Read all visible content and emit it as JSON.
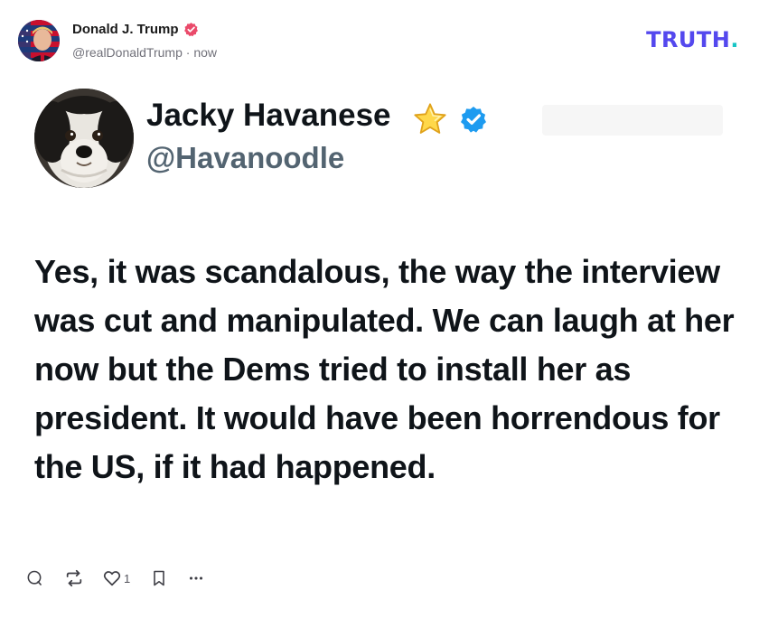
{
  "author": {
    "name": "Donald J. Trump",
    "handle": "@realDonaldTrump",
    "time": "now",
    "meta_separator": " · "
  },
  "brand": {
    "logo_text": "TRUTH",
    "logo_dot": ".",
    "color": "#5448ee",
    "dot_color": "#17c5c5"
  },
  "embedded_post": {
    "name": "Jacky Havanese",
    "handle": "@Havanoodle",
    "badge_icons": [
      "star-icon",
      "verified-icon"
    ],
    "text": "Yes, it was scandalous, the way the interview was cut and manipulated. We can laugh at her now but the Dems tried to install her as president. It would have been horrendous for the US, if it had happened."
  },
  "actions": {
    "icons": [
      "reply-icon",
      "repost-icon",
      "like-icon",
      "bookmark-icon",
      "more-icon"
    ],
    "like_count": "1"
  },
  "colors": {
    "verified_pink": "#ea4a6a",
    "verified_blue": "#1d9bf0",
    "muted_text": "#71717a",
    "handle_gray": "#536471"
  }
}
